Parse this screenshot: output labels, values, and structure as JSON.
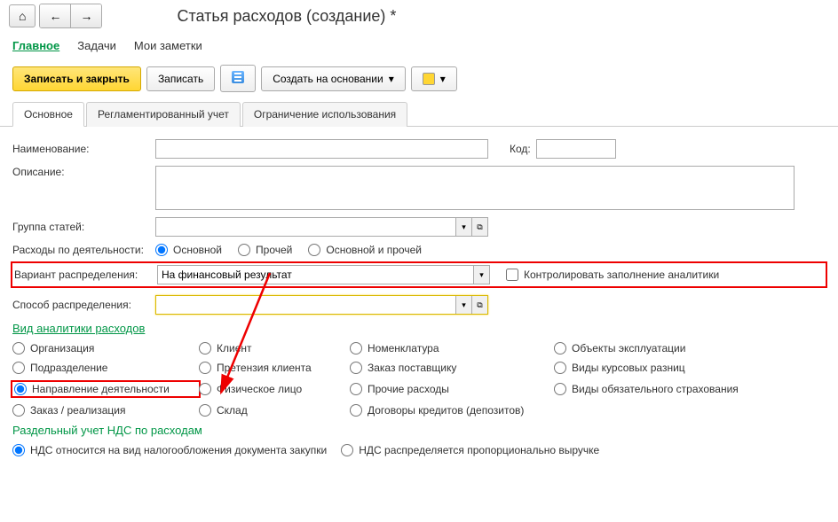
{
  "header": {
    "title": "Статья расходов (создание) *"
  },
  "nav": {
    "main": "Главное",
    "tasks": "Задачи",
    "notes": "Мои заметки"
  },
  "actions": {
    "save_close": "Записать и закрыть",
    "save": "Записать",
    "create_based": "Создать на основании"
  },
  "tabs": {
    "main": "Основное",
    "reg": "Регламентированный учет",
    "limit": "Ограничение использования"
  },
  "form": {
    "name_lbl": "Наименование:",
    "code_lbl": "Код:",
    "desc_lbl": "Описание:",
    "group_lbl": "Группа статей:",
    "activity_lbl": "Расходы по деятельности:",
    "activity_main": "Основной",
    "activity_other": "Прочей",
    "activity_both": "Основной и прочей",
    "variant_lbl": "Вариант распределения:",
    "variant_value": "На финансовый результат",
    "control_chk": "Контролировать заполнение аналитики",
    "method_lbl": "Способ распределения:",
    "analytics_hdr": "Вид аналитики расходов",
    "vat_hdr": "Раздельный учет НДС по расходам",
    "vat_opt1": "НДС относится на вид налогообложения документа закупки",
    "vat_opt2": "НДС распределяется пропорционально выручке"
  },
  "analytics": {
    "org": "Организация",
    "dept": "Подразделение",
    "direction": "Направление деятельности",
    "order": "Заказ / реализация",
    "client": "Клиент",
    "claim": "Претензия клиента",
    "person": "Физическое лицо",
    "warehouse": "Склад",
    "nomenclature": "Номенклатура",
    "supplier_order": "Заказ поставщику",
    "other_exp": "Прочие расходы",
    "credit": "Договоры кредитов (депозитов)",
    "objects": "Объекты эксплуатации",
    "fx": "Виды курсовых разниц",
    "insurance": "Виды обязательного страхования"
  }
}
